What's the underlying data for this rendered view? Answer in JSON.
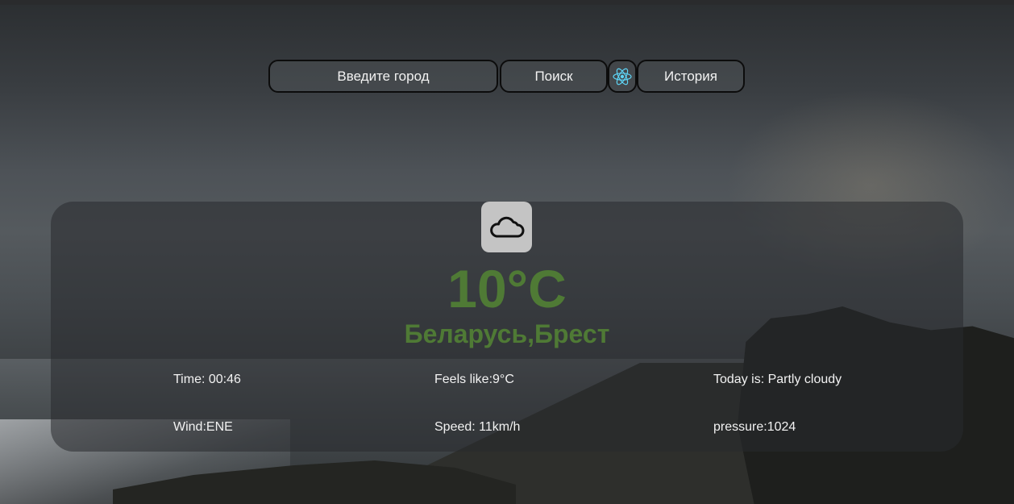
{
  "search": {
    "placeholder": "Введите город",
    "search_label": "Поиск",
    "history_label": "История"
  },
  "weather": {
    "icon": "cloud-icon",
    "temperature": "10°C",
    "location": "Беларусь,Брест",
    "time": "Time: 00:46",
    "feels_like": "Feels like:9°C",
    "today": "Today is: Partly cloudy",
    "wind": "Wind:ENE",
    "speed": "Speed: 11km/h",
    "pressure": "pressure:1024"
  },
  "colors": {
    "accent_green": "#4f7a35",
    "react_blue": "#5ed4f5",
    "icon_box": "#c4c4c4"
  }
}
